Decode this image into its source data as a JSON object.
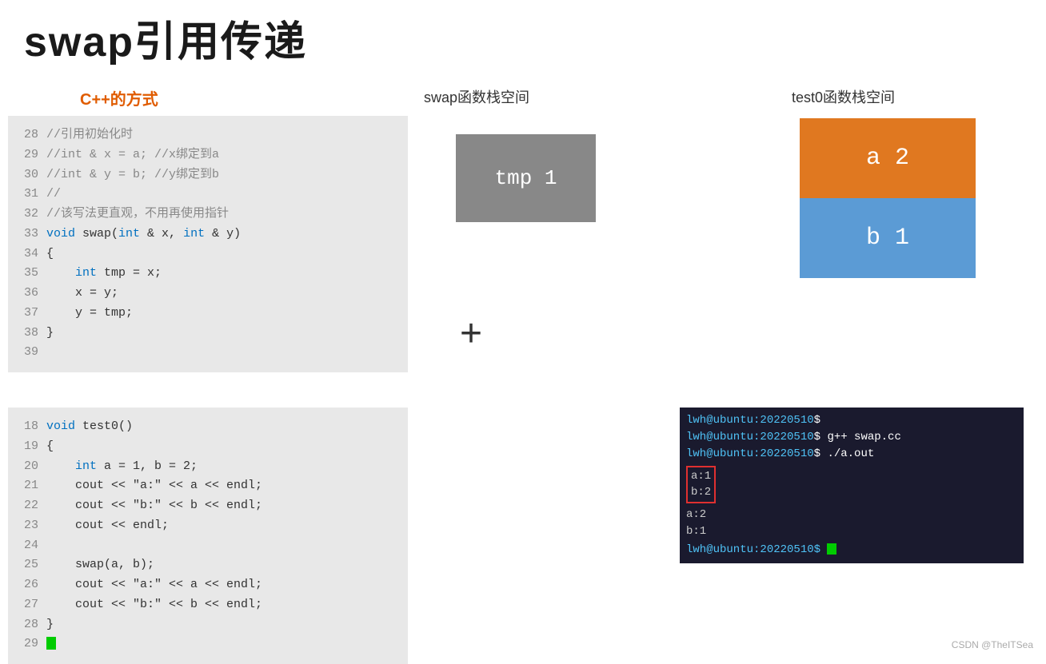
{
  "title": "swap引用传递",
  "cpp_label": "C++的方式",
  "swap_stack_label": "swap函数栈空间",
  "test0_stack_label": "test0函数栈空间",
  "tmp_box": {
    "text": "tmp 1"
  },
  "plus_sign": "+",
  "stack_a": {
    "text": "a 2"
  },
  "stack_b": {
    "text": "b 1"
  },
  "code_top": [
    {
      "num": "28",
      "content": "//引用初始化时"
    },
    {
      "num": "29",
      "content": "//int & x = a; //x绑定到a"
    },
    {
      "num": "30",
      "content": "//int & y = b; //y绑定到b"
    },
    {
      "num": "31",
      "content": "//"
    },
    {
      "num": "32",
      "content": "//该写法更直观，不用再使用指针"
    },
    {
      "num": "33",
      "content": "void swap(int & x, int & y)"
    },
    {
      "num": "34",
      "content": "{"
    },
    {
      "num": "35",
      "content": "    int tmp = x;"
    },
    {
      "num": "36",
      "content": "    x = y;"
    },
    {
      "num": "37",
      "content": "    y = tmp;"
    },
    {
      "num": "38",
      "content": "}"
    },
    {
      "num": "39",
      "content": ""
    }
  ],
  "code_bottom": [
    {
      "num": "18",
      "content": "void test0()"
    },
    {
      "num": "19",
      "content": "{"
    },
    {
      "num": "20",
      "content": "    int a = 1, b = 2;"
    },
    {
      "num": "21",
      "content": "    cout << \"a:\" << a << endl;"
    },
    {
      "num": "22",
      "content": "    cout << \"b:\" << b << endl;"
    },
    {
      "num": "23",
      "content": "    cout << endl;"
    },
    {
      "num": "24",
      "content": ""
    },
    {
      "num": "25",
      "content": "    swap(a, b);"
    },
    {
      "num": "26",
      "content": "    cout << \"a:\" << a << endl;"
    },
    {
      "num": "27",
      "content": "    cout << \"b:\" << b << endl;"
    },
    {
      "num": "28",
      "content": "}"
    },
    {
      "num": "29",
      "content": ""
    }
  ],
  "terminal": {
    "line1_prompt": "lwh@ubuntu:20220510",
    "line1_suffix": "$",
    "line2_prompt": "lwh@ubuntu:20220510",
    "line2_cmd": "$ g++ swap.cc",
    "line3_prompt": "lwh@ubuntu:20220510",
    "line3_cmd": "$ ./a.out",
    "output_box": "a:1\nb:2",
    "output_plain": "a:2\nb:1",
    "line_end_prompt": "lwh@ubuntu:20220510$"
  },
  "watermark": "CSDN @TheITSea"
}
